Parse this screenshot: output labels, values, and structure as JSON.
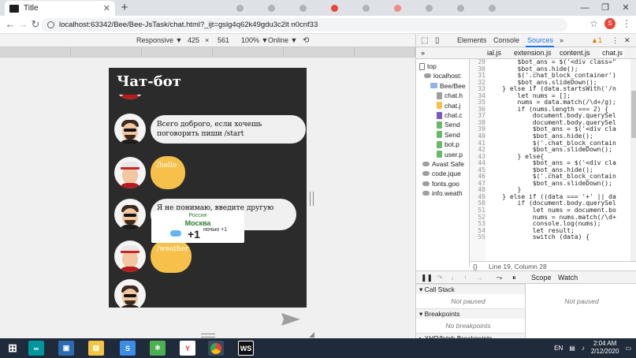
{
  "browser": {
    "tab_title": "Title",
    "new_tab": "+",
    "close": "✕",
    "window_controls": [
      "—",
      "❐",
      "✕"
    ],
    "back": "←",
    "forward": "→",
    "reload": "↻",
    "url": "localhost:63342/Bee/Bee-JsTask/chat.html?_ijt=gslg4q62k49gdu3c2lt n0cnf33",
    "profile_initial": "S",
    "menu": "⋮",
    "star": "☆"
  },
  "device_toolbar": {
    "device": "Responsive ▼",
    "width": "425",
    "x": "×",
    "height": "561",
    "zoom": "100% ▼",
    "network": "Online ▼"
  },
  "chat": {
    "title": "Чат-бот",
    "messages": [
      {
        "role": "bot",
        "text": "Всего доброго, если хочешь поговорить пиши /start"
      },
      {
        "role": "user",
        "text": "/hello"
      },
      {
        "role": "bot",
        "text": "Я не понимаю, введите другую команду!"
      },
      {
        "role": "user",
        "text": "/weather"
      }
    ],
    "weather": {
      "country": "Россия",
      "city": "Москва",
      "temp": "+1",
      "night": "ночью +1"
    }
  },
  "devtools": {
    "tabs": [
      "Elements",
      "Console",
      "Sources"
    ],
    "active_tab": "Sources",
    "more": "»",
    "warnings": "▲1",
    "files_open": [
      "ial.js",
      "extension.js",
      "content.js",
      "chat.js"
    ],
    "navigator": [
      {
        "label": "top",
        "type": "frame"
      },
      {
        "label": "localhost:",
        "type": "cloud"
      },
      {
        "label": "Bee/Bee",
        "type": "folder"
      },
      {
        "label": "chat.h",
        "type": "file",
        "color": "#9e9e9e"
      },
      {
        "label": "chat.j",
        "type": "file",
        "color": "#f7c04a"
      },
      {
        "label": "chat.c",
        "type": "file",
        "color": "#7e57c2"
      },
      {
        "label": "Send",
        "type": "file",
        "color": "#66bb6a"
      },
      {
        "label": "Send",
        "type": "file",
        "color": "#66bb6a"
      },
      {
        "label": "bot.p",
        "type": "file",
        "color": "#66bb6a"
      },
      {
        "label": "user.p",
        "type": "file",
        "color": "#66bb6a"
      },
      {
        "label": "Avast Safe",
        "type": "cloud"
      },
      {
        "label": "code.jque",
        "type": "cloud"
      },
      {
        "label": "fonts.goo",
        "type": "cloud"
      },
      {
        "label": "info.weath",
        "type": "cloud"
      }
    ],
    "line_numbers": [
      "29",
      "30",
      "31",
      "32",
      "33",
      "34",
      "35",
      "36",
      "37",
      "38",
      "39",
      "40",
      "41",
      "42",
      "43",
      "44",
      "45",
      "46",
      "47",
      "48",
      "49",
      "50",
      "51",
      "52",
      "53",
      "54",
      "55"
    ],
    "code_lines": [
      "        $bot_ans = $('<div class=\"",
      "        $bot_ans.hide();",
      "        $('.chat_block_container')",
      "        $bot_ans.slideDown();",
      "    } else if (data.startsWith('/n",
      "        let nums = [];",
      "        nums = data.match(/\\d+/g);",
      "        if (nums.length === 2) {",
      "            document.body.querySel",
      "            document.body.querySel",
      "            $bot_ans = $('<div cla",
      "            $bot_ans.hide();",
      "            $('.chat_block_contain",
      "            $bot_ans.slideDown();",
      "        } else{",
      "            $bot_ans = $('<div cla",
      "            $bot_ans.hide();",
      "            $('.chat_block_contain",
      "            $bot_ans.slideDown();",
      "        }",
      "    } else if ((data === '+' || da",
      "        if (document.body.querySel",
      "            let nums = document.bo",
      "            nums = nums.match(/\\d+",
      "            console.log(nums);",
      "            let result;",
      "            switch (data) {"
    ],
    "status": "Line 19, Column 28",
    "braces": "{}",
    "scope_tab": "Scope",
    "watch_tab": "Watch",
    "call_stack": "Call Stack",
    "not_paused": "Not paused",
    "breakpoints": "Breakpoints",
    "no_breakpoints": "No breakpoints",
    "xhr_breakpoints": "XHR/fetch Breakpoints",
    "top_label": "top"
  },
  "taskbar": {
    "lang": "EN",
    "time": "2:04 AM",
    "date": "2/12/2020"
  }
}
